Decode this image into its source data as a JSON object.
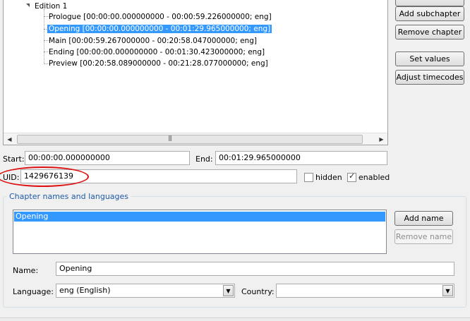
{
  "tree": {
    "edition_label": "Edition 1",
    "chapters": [
      "Prologue [00:00:00.000000000 - 00:00:59.226000000; eng]",
      "Opening [00:00:00.000000000 - 00:01:29.965000000; eng]",
      "Main [00:00:59.267000000 - 00:20:58.047000000; eng]",
      "Ending [00:00:00.000000000 - 00:01:30.423000000; eng]",
      "Preview [00:20:58.089000000 - 00:21:28.077000000; eng]"
    ],
    "selected_index": 1
  },
  "side_buttons": {
    "add_subchapter": "Add subchapter",
    "remove_chapter": "Remove chapter",
    "set_values": "Set values",
    "adjust_timecodes": "Adjust timecodes"
  },
  "timing": {
    "start_label": "Start:",
    "start_value": "00:00:00.000000000",
    "end_label": "End:",
    "end_value": "00:01:29.965000000"
  },
  "uid": {
    "label": "UID:",
    "value": "1429676139",
    "annotation_color": "#dd1111"
  },
  "flags": {
    "hidden_label": "hidden",
    "hidden_checked": false,
    "enabled_label": "enabled",
    "enabled_checked": true
  },
  "names_group": {
    "title": "Chapter names and languages",
    "names": [
      "Opening"
    ],
    "add_name": "Add name",
    "remove_name": "Remove name",
    "name_label": "Name:",
    "name_value": "Opening",
    "language_label": "Language:",
    "language_value": "eng (English)",
    "country_label": "Country:",
    "country_value": ""
  },
  "colors": {
    "selection": "#3399ff",
    "group_title": "#1e5aa8"
  }
}
